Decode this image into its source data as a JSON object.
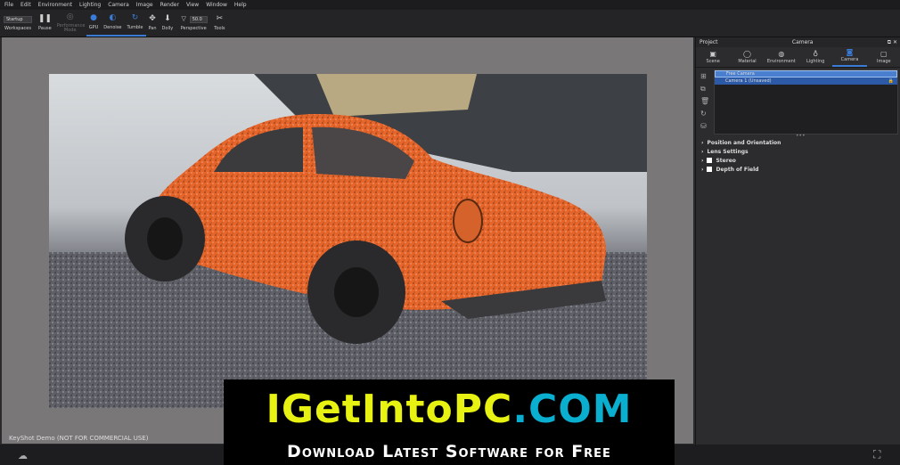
{
  "menu": [
    "File",
    "Edit",
    "Environment",
    "Lighting",
    "Camera",
    "Image",
    "Render",
    "View",
    "Window",
    "Help"
  ],
  "toolbar": {
    "workspace_value": "Startup",
    "workspaces": "Workspaces",
    "pause": "Pause",
    "performance_mode": "Performance Mode",
    "gpu": "GPU",
    "denoise": "Denoise",
    "tumble": "Tumble",
    "pan": "Pan",
    "dolly": "Dolly",
    "fov_value": "50.0",
    "perspective": "Perspective",
    "tools": "Tools"
  },
  "viewport": {
    "watermark": "KeyShot Demo (NOT FOR COMMERCIAL USE)"
  },
  "panel": {
    "left_title": "Project",
    "title": "Camera",
    "tabs": [
      "Scene",
      "Material",
      "Environment",
      "Lighting",
      "Camera",
      "Image"
    ],
    "active_tab": "Camera",
    "cameras": [
      "Free Camera",
      "Camera 1 (Unsaved)"
    ],
    "sections": [
      "Position and Orientation",
      "Lens Settings",
      "Stereo",
      "Depth of Field"
    ]
  },
  "banner": {
    "brand_part1": "IGetIntoPC",
    "brand_part2": ".com",
    "tagline": "Download Latest Software for Free"
  },
  "colors": {
    "accent": "#3a7bd5",
    "brand_yellow": "#e7f212",
    "brand_cyan": "#0aaecf",
    "car_orange": "#e8652a"
  }
}
